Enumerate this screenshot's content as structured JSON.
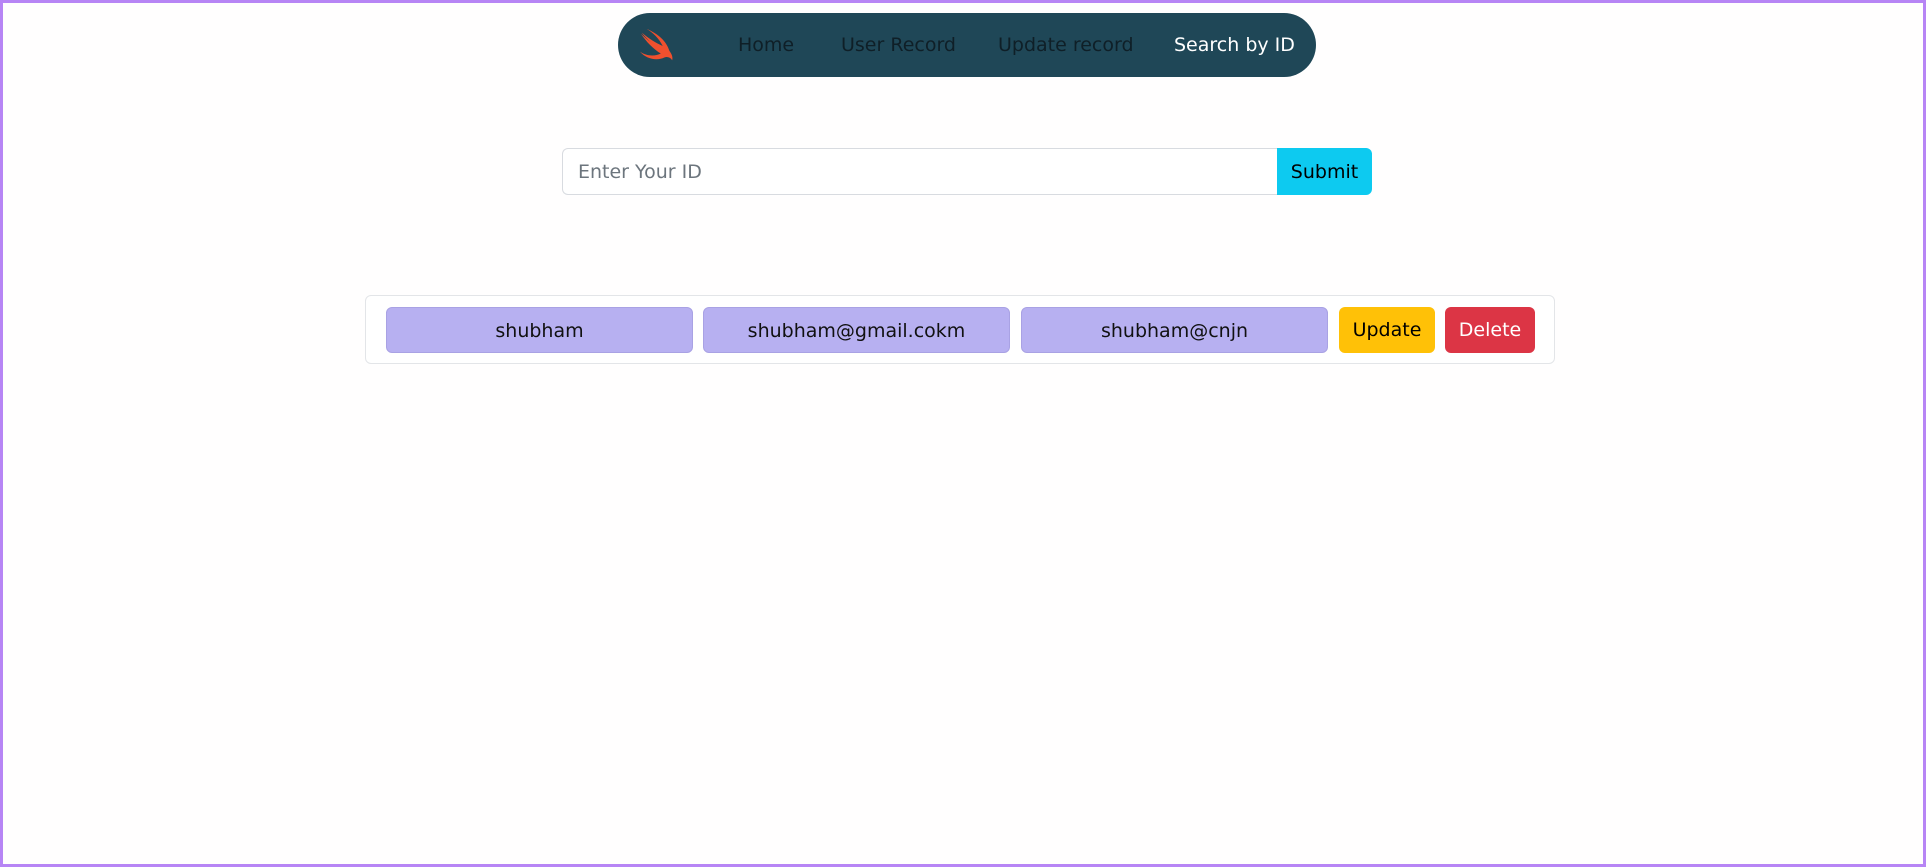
{
  "nav": {
    "logo_icon": "swift-logo-icon",
    "links": [
      {
        "label": "Home",
        "active": false
      },
      {
        "label": "User Record",
        "active": false
      },
      {
        "label": "Update record",
        "active": false
      },
      {
        "label": "Search by ID",
        "active": true
      }
    ]
  },
  "search": {
    "placeholder": "Enter Your ID",
    "value": "",
    "submit_label": "Submit"
  },
  "record": {
    "name": "shubham",
    "email": "shubham@gmail.cokm",
    "password": "shubham@cnjn",
    "update_label": "Update",
    "delete_label": "Delete"
  },
  "colors": {
    "frame_border": "#b785f5",
    "navbar_bg": "#1f4757",
    "submit": "#0dcaf0",
    "field_bg": "#b7b0f1",
    "update": "#ffc107",
    "delete": "#dc3545"
  }
}
